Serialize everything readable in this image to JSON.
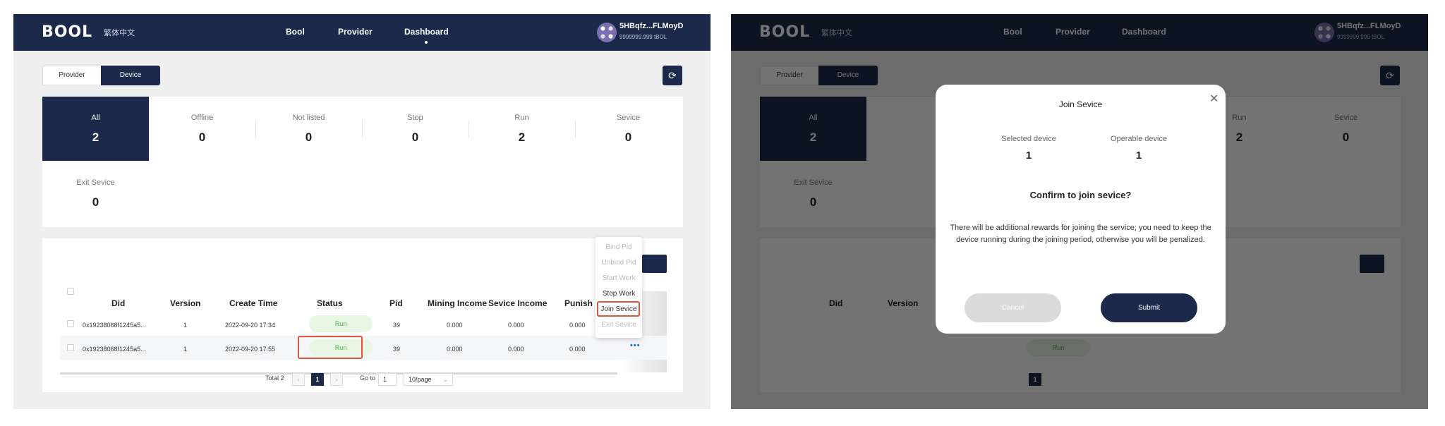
{
  "header": {
    "logo": "BOOL",
    "lang": "繁体中文",
    "nav": [
      "Bool",
      "Provider",
      "Dashboard"
    ],
    "account": "5HBqfz...FLMoyD",
    "balance": "9999999.999 tBOL"
  },
  "tabs": {
    "provider": "Provider",
    "device": "Device"
  },
  "stats": [
    {
      "label": "All",
      "value": "2"
    },
    {
      "label": "Offline",
      "value": "0"
    },
    {
      "label": "Not listed",
      "value": "0"
    },
    {
      "label": "Stop",
      "value": "0"
    },
    {
      "label": "Run",
      "value": "2"
    },
    {
      "label": "Sevice",
      "value": "0"
    },
    {
      "label": "Exit Sevice",
      "value": "0"
    }
  ],
  "table": {
    "headers": [
      "Did",
      "Version",
      "Create Time",
      "Status",
      "Pid",
      "Mining Income",
      "Sevice Income",
      "Punish"
    ],
    "rows": [
      {
        "did": "0x19238068f1245a5...",
        "version": "1",
        "create_time": "2022-09-20 17:34",
        "status": "Run",
        "pid": "39",
        "mining": "0.000",
        "sevice": "0.000",
        "punish": "0.000"
      },
      {
        "did": "0x19238068f1245a5...",
        "version": "1",
        "create_time": "2022-09-20 17:55",
        "status": "Run",
        "pid": "39",
        "mining": "0.000",
        "sevice": "0.000",
        "punish": "0.000"
      }
    ],
    "more": "•••"
  },
  "pagination": {
    "total": "Total 2",
    "current": "1",
    "goto_label": "Go to",
    "goto_value": "1",
    "page_size": "10/page",
    "prev": "‹",
    "next": "›"
  },
  "actions_menu": [
    "Bind Pid",
    "Unbind Pid",
    "Start Work",
    "Stop Work",
    "Join Sevice",
    "Exit Sevice"
  ],
  "modal": {
    "title": "Join Sevice",
    "selected_label": "Selected device",
    "selected_value": "1",
    "operable_label": "Operable device",
    "operable_value": "1",
    "question": "Confirm to join sevice?",
    "message": "There will be additional rewards for joining the service; you need to keep the device running during the joining period, otherwise you will be penalized.",
    "cancel": "Cancel",
    "submit": "Submit"
  },
  "colors": {
    "brand": "#1b2a4a",
    "run_text": "#4caf50",
    "run_bg": "#e8f7e4",
    "highlight": "#e0533d"
  }
}
